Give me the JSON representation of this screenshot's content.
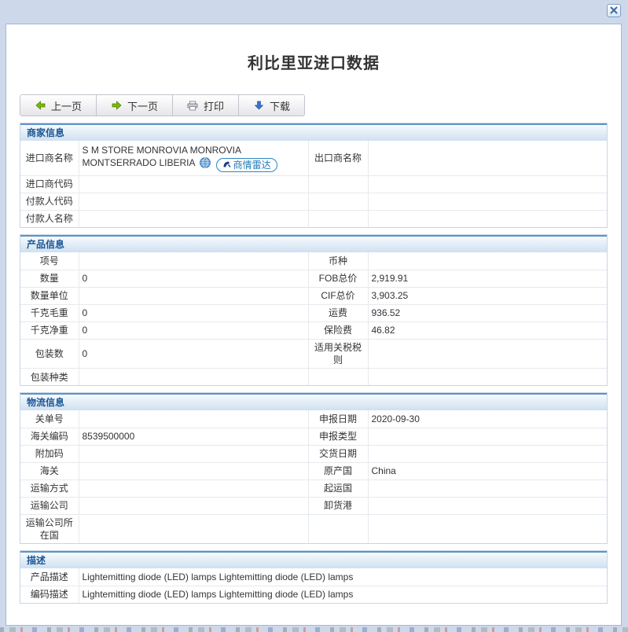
{
  "title": "利比里亚进口数据",
  "toolbar": {
    "prev_label": "上一页",
    "next_label": "下一页",
    "print_label": "打印",
    "download_label": "下载"
  },
  "merchant": {
    "title": "商家信息",
    "importer_badge_label": "商情雷达",
    "rows": [
      {
        "l1": "进口商名称",
        "v1": "S M STORE MONROVIA MONROVIA MONTSERRADO LIBERIA",
        "l2": "出口商名称",
        "v2": ""
      },
      {
        "l1": "进口商代码",
        "v1": "",
        "l2": "",
        "v2": ""
      },
      {
        "l1": "付款人代码",
        "v1": "",
        "l2": "",
        "v2": ""
      },
      {
        "l1": "付款人名称",
        "v1": "",
        "l2": "",
        "v2": ""
      }
    ]
  },
  "product": {
    "title": "产品信息",
    "rows": [
      {
        "l1": "项号",
        "v1": "",
        "l2": "币种",
        "v2": ""
      },
      {
        "l1": "数量",
        "v1": "0",
        "l2": "FOB总价",
        "v2": "2,919.91"
      },
      {
        "l1": "数量单位",
        "v1": "",
        "l2": "CIF总价",
        "v2": "3,903.25"
      },
      {
        "l1": "千克毛重",
        "v1": "0",
        "l2": "运费",
        "v2": "936.52"
      },
      {
        "l1": "千克净重",
        "v1": "0",
        "l2": "保险费",
        "v2": "46.82"
      },
      {
        "l1": "包装数",
        "v1": "0",
        "l2": "适用关税税则",
        "v2": ""
      },
      {
        "l1": "包装种类",
        "v1": "",
        "l2": "",
        "v2": ""
      }
    ]
  },
  "logistics": {
    "title": "物流信息",
    "rows": [
      {
        "l1": "关单号",
        "v1": "",
        "l2": "申报日期",
        "v2": "2020-09-30"
      },
      {
        "l1": "海关编码",
        "v1": "8539500000",
        "l2": "申报类型",
        "v2": ""
      },
      {
        "l1": "附加码",
        "v1": "",
        "l2": "交货日期",
        "v2": ""
      },
      {
        "l1": "海关",
        "v1": "",
        "l2": "原产国",
        "v2": "China"
      },
      {
        "l1": "运输方式",
        "v1": "",
        "l2": "起运国",
        "v2": ""
      },
      {
        "l1": "运输公司",
        "v1": "",
        "l2": "卸货港",
        "v2": ""
      },
      {
        "l1": "运输公司所在国",
        "v1": "",
        "l2": "",
        "v2": ""
      }
    ]
  },
  "description": {
    "title": "描述",
    "rows": [
      {
        "l": "产品描述",
        "v": "Lightemitting diode (LED) lamps Lightemitting diode (LED) lamps"
      },
      {
        "l": "编码描述",
        "v": "Lightemitting diode (LED) lamps Lightemitting diode (LED) lamps"
      }
    ]
  },
  "colors": {
    "backdrop": "#cdd9ea",
    "modal_border": "#9fb9da",
    "section_header_text": "#1a5696",
    "section_header_line": "#6192c2",
    "section_header_bg": "#cfe0f1",
    "badge_blue": "#2e86c1",
    "arrow_green": "#7cb800",
    "arrow_blue": "#3b74c9",
    "close_x_blue": "#3a67a8"
  }
}
